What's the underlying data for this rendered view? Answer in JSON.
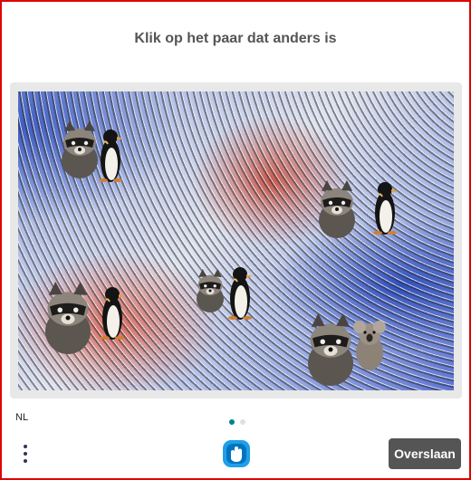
{
  "challenge": {
    "instruction": "Klik op het paar dat anders is"
  },
  "footer": {
    "language": "NL",
    "skip_label": "Overslaan",
    "page_dots": {
      "count": 2,
      "active_index": 0
    },
    "menu_icon": "vertical-dots-icon",
    "logo_icon": "hcaptcha-hand-icon"
  },
  "colors": {
    "frame_border": "#e00000",
    "dot_active": "#00838f",
    "dot_inactive": "#e0e0e0",
    "skip_button_bg": "#555555"
  },
  "pairs": [
    {
      "name": "pair-top-left",
      "animals": [
        "raccoon",
        "penguin"
      ]
    },
    {
      "name": "pair-right-upper",
      "animals": [
        "raccoon",
        "penguin"
      ]
    },
    {
      "name": "pair-center",
      "animals": [
        "raccoon",
        "penguin"
      ]
    },
    {
      "name": "pair-bottom-left",
      "animals": [
        "raccoon",
        "penguin"
      ]
    },
    {
      "name": "pair-bottom-right",
      "animals": [
        "raccoon",
        "koala"
      ]
    }
  ]
}
